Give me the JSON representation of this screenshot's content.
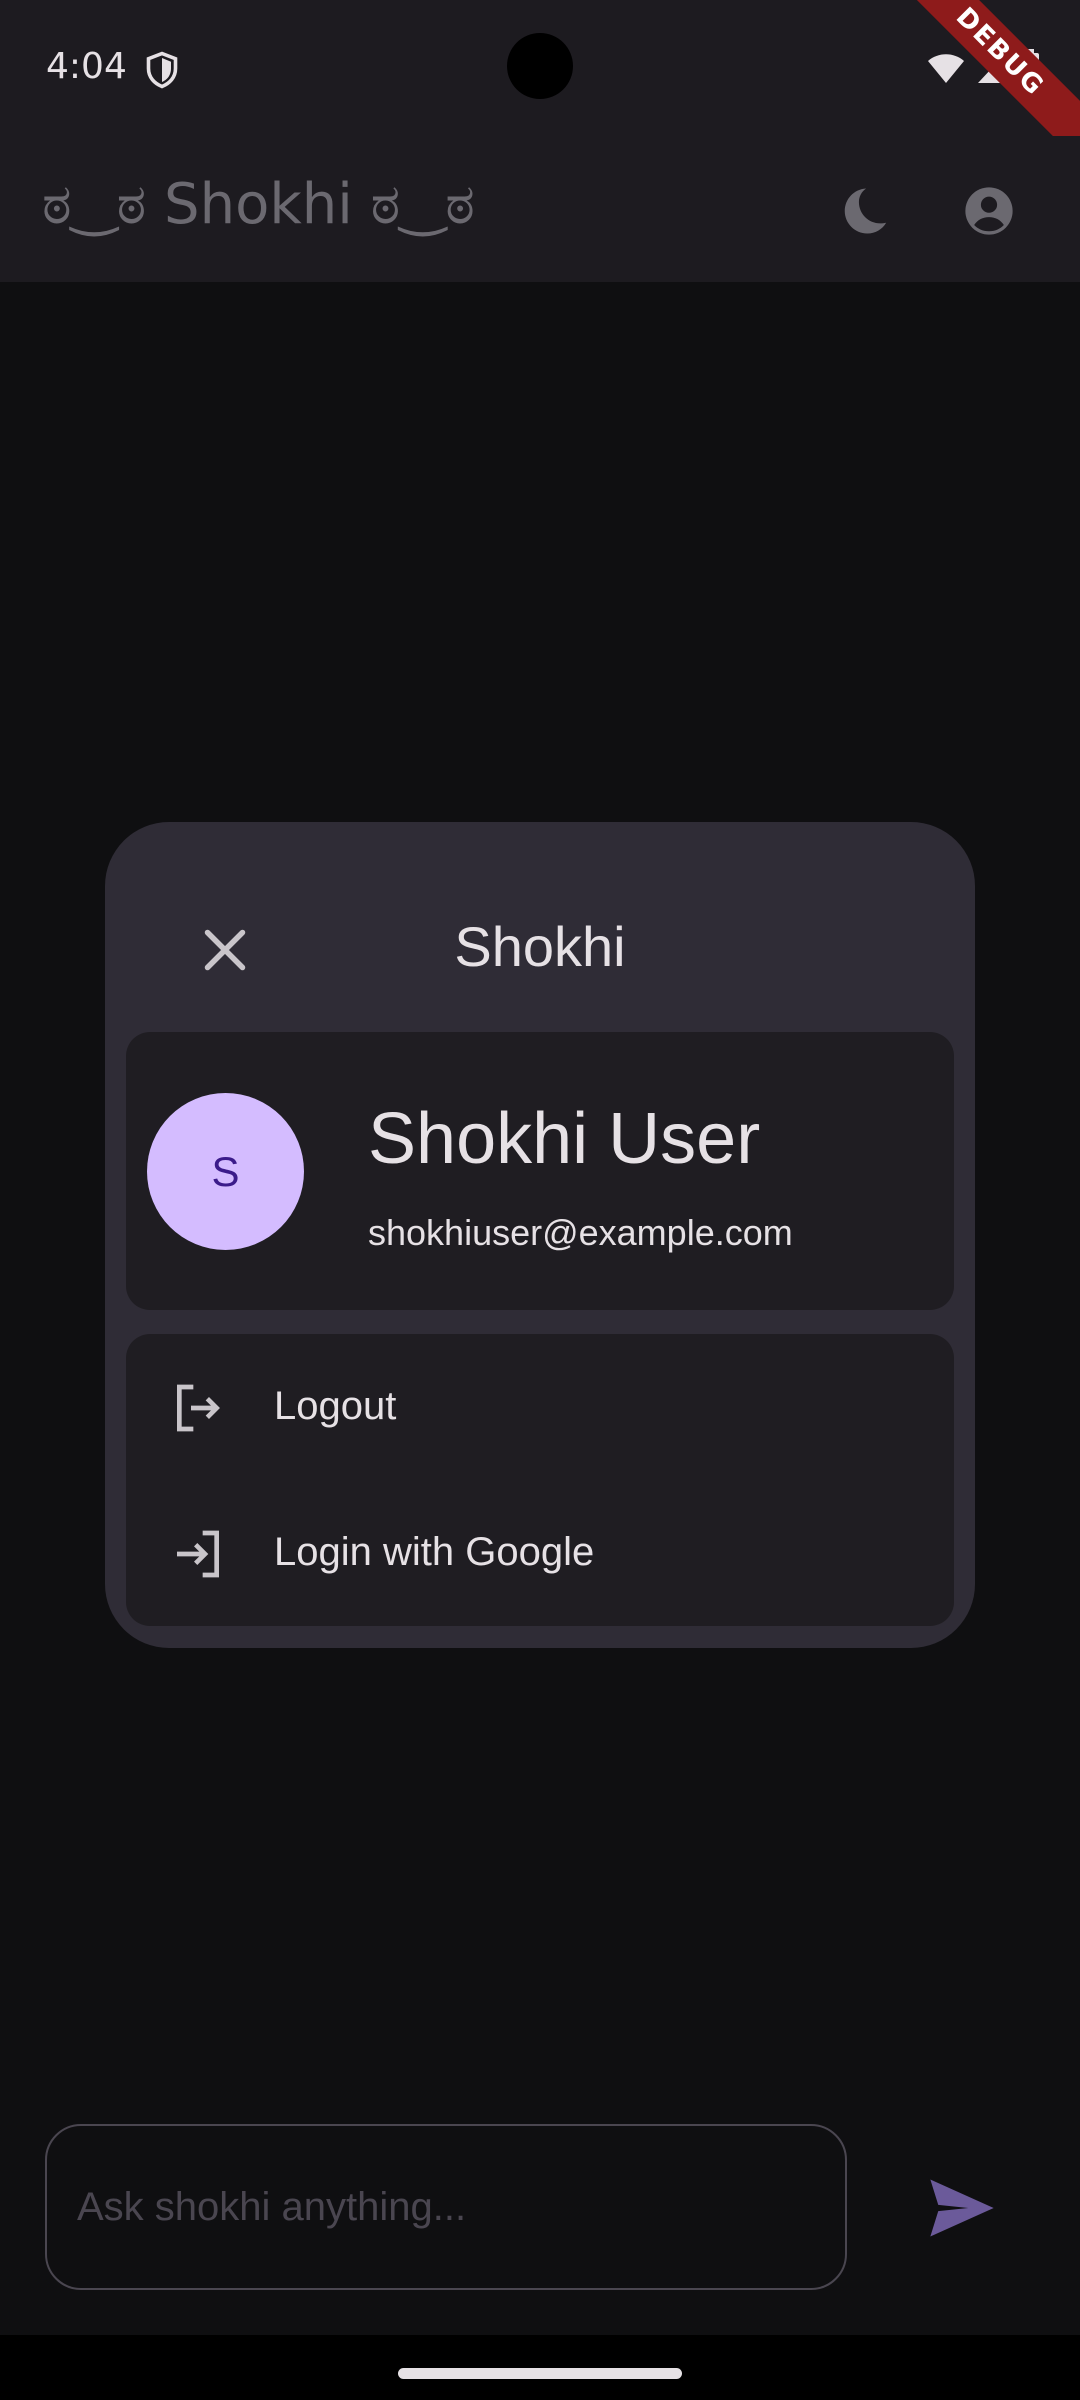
{
  "status_bar": {
    "time": "4:04",
    "debug_label": "DEBUG"
  },
  "app_bar": {
    "title": "ಠ‿ಠ Shokhi ಠ‿ಠ",
    "icons": [
      "moon-icon",
      "account-circle-icon"
    ]
  },
  "dialog": {
    "title": "Shokhi",
    "close_icon": "close-icon",
    "profile": {
      "avatar_initial": "S",
      "name": "Shokhi User",
      "email": "shokhiuser@example.com"
    },
    "actions": [
      {
        "label": "Logout",
        "icon": "logout-icon"
      },
      {
        "label": "Login with Google",
        "icon": "login-icon"
      }
    ]
  },
  "chat": {
    "placeholder": "Ask shokhi anything...",
    "send_icon": "send-icon"
  },
  "colors": {
    "background": "#0f0f11",
    "app_bar": "#1d1b20",
    "dialog": "#2f2c36",
    "card": "#1f1d22",
    "avatar": "#d4bcff",
    "accent": "#6b5a9a",
    "debug_banner": "#8e1b1b"
  }
}
